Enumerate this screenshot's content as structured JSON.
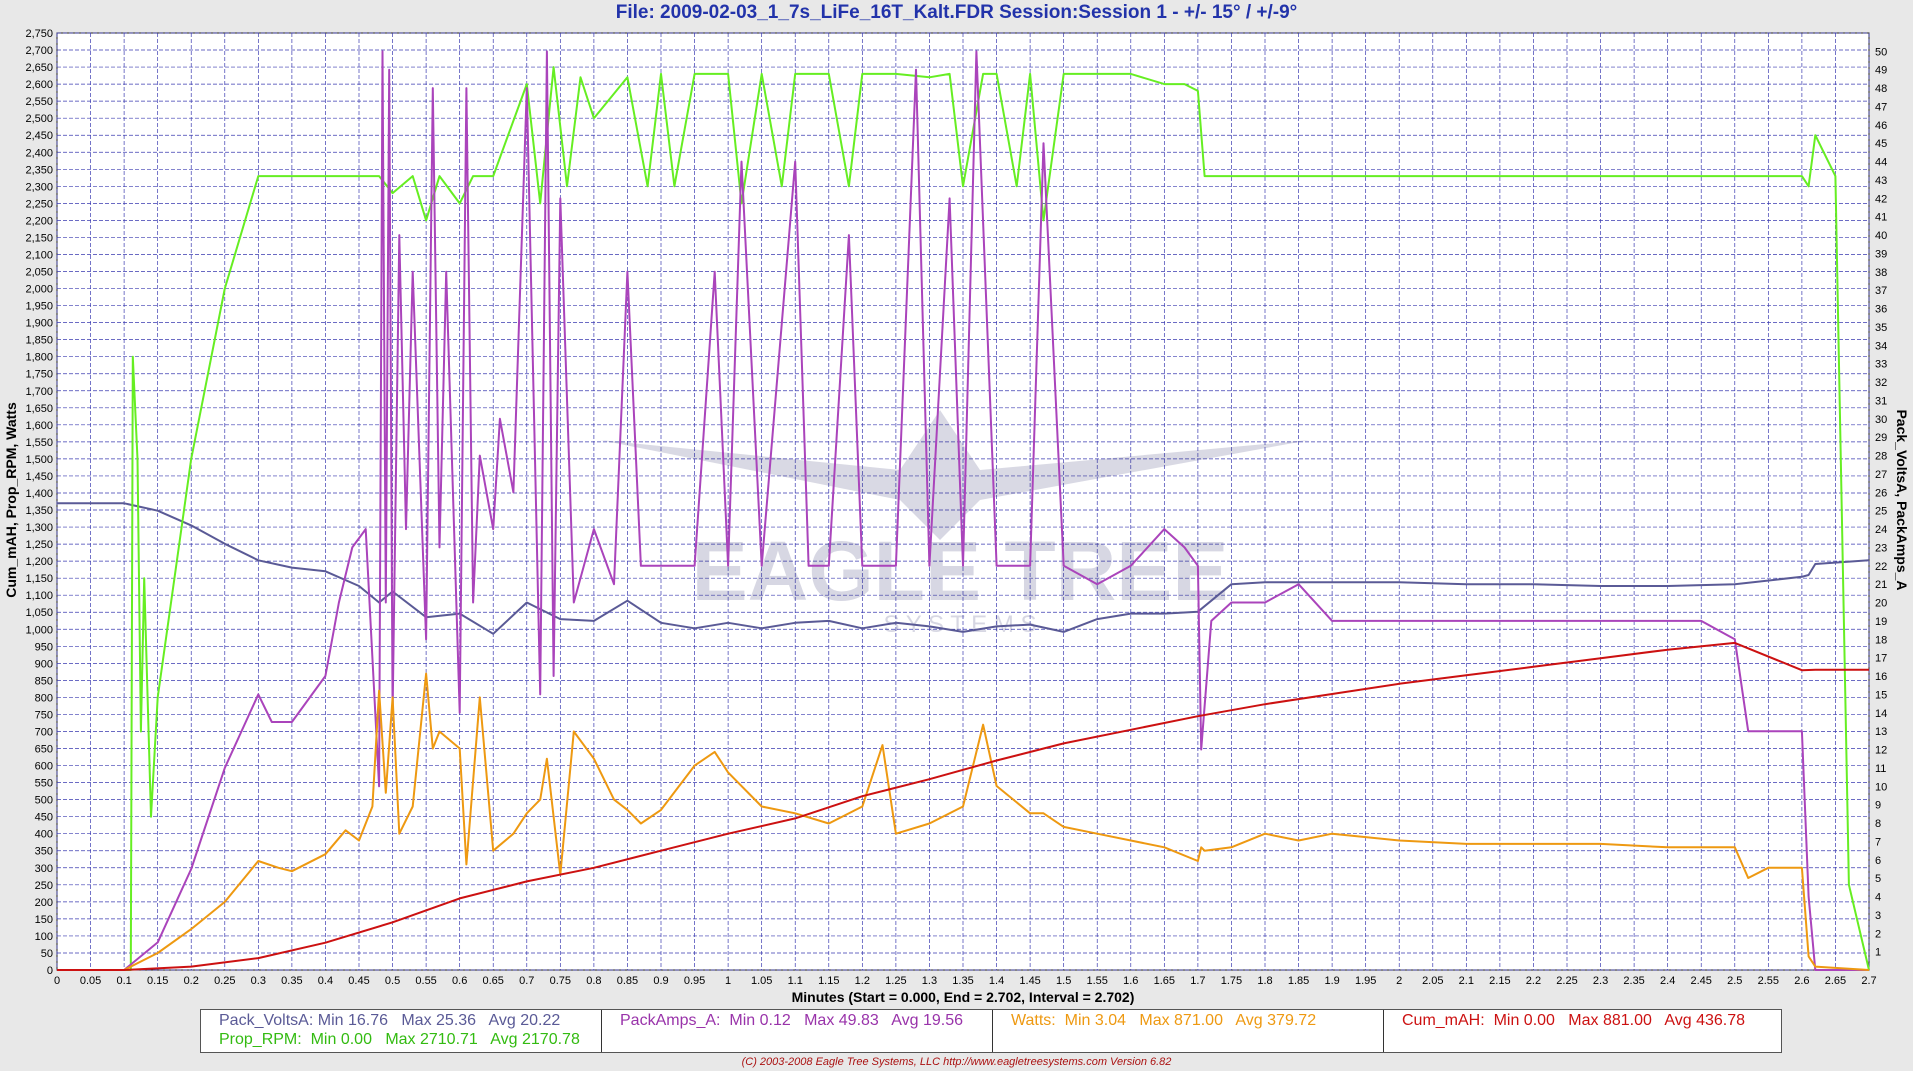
{
  "title": "File: 2009-02-03_1_7s_LiFe_16T_Kalt.FDR   Session:Session 1 - +/- 15° / +/-9°",
  "watermark": {
    "line1": "EAGLE TREE",
    "line2": "S Y S T E M S"
  },
  "chart_data": {
    "type": "line",
    "xlabel": "Minutes (Start = 0.000,  End = 2.702,  Interval =  2.702)",
    "ylabel_left": "Cum_mAH, Prop_RPM, Watts",
    "ylabel_right": "Pack_VoltsA, PackAmps_A",
    "xlim": [
      0,
      2.7
    ],
    "ylim_left": [
      0,
      2750
    ],
    "ylim_right": [
      0,
      51
    ],
    "x_ticks": [
      "0",
      "0.05",
      "0.1",
      "0.15",
      "0.2",
      "0.25",
      "0.3",
      "0.35",
      "0.4",
      "0.45",
      "0.5",
      "0.55",
      "0.6",
      "0.65",
      "0.7",
      "0.75",
      "0.8",
      "0.85",
      "0.9",
      "0.95",
      "1",
      "1.05",
      "1.1",
      "1.15",
      "1.2",
      "1.25",
      "1.3",
      "1.35",
      "1.4",
      "1.45",
      "1.5",
      "1.55",
      "1.6",
      "1.65",
      "1.7",
      "1.75",
      "1.8",
      "1.85",
      "1.9",
      "1.95",
      "2",
      "2.05",
      "2.1",
      "2.15",
      "2.2",
      "2.25",
      "2.3",
      "2.35",
      "2.4",
      "2.45",
      "2.5",
      "2.55",
      "2.6",
      "2.65",
      "2.7"
    ],
    "y_left_ticks": [
      "0",
      "50",
      "100",
      "150",
      "200",
      "250",
      "300",
      "350",
      "400",
      "450",
      "500",
      "550",
      "600",
      "650",
      "700",
      "750",
      "800",
      "850",
      "900",
      "950",
      "1,000",
      "1,050",
      "1,100",
      "1,150",
      "1,200",
      "1,250",
      "1,300",
      "1,350",
      "1,400",
      "1,450",
      "1,500",
      "1,550",
      "1,600",
      "1,650",
      "1,700",
      "1,750",
      "1,800",
      "1,850",
      "1,900",
      "1,950",
      "2,000",
      "2,050",
      "2,100",
      "2,150",
      "2,200",
      "2,250",
      "2,300",
      "2,350",
      "2,400",
      "2,450",
      "2,500",
      "2,550",
      "2,600",
      "2,650",
      "2,700",
      "2,750"
    ],
    "y_right_ticks": [
      "1",
      "2",
      "3",
      "4",
      "5",
      "6",
      "7",
      "8",
      "9",
      "10",
      "11",
      "12",
      "13",
      "14",
      "15",
      "16",
      "17",
      "18",
      "19",
      "20",
      "21",
      "22",
      "23",
      "24",
      "25",
      "26",
      "27",
      "28",
      "29",
      "30",
      "31",
      "32",
      "33",
      "34",
      "35",
      "36",
      "37",
      "38",
      "39",
      "40",
      "41",
      "42",
      "43",
      "44",
      "45",
      "46",
      "47",
      "48",
      "49",
      "50"
    ],
    "grid": true,
    "series": [
      {
        "name": "Pack_VoltsA",
        "axis": "right",
        "color": "#5a5a96",
        "x": [
          0,
          0.1,
          0.15,
          0.2,
          0.25,
          0.3,
          0.35,
          0.4,
          0.45,
          0.48,
          0.5,
          0.55,
          0.6,
          0.65,
          0.7,
          0.75,
          0.8,
          0.85,
          0.9,
          0.95,
          1,
          1.05,
          1.1,
          1.15,
          1.2,
          1.25,
          1.3,
          1.35,
          1.4,
          1.45,
          1.5,
          1.55,
          1.6,
          1.65,
          1.7,
          1.75,
          1.8,
          1.9,
          2,
          2.1,
          2.2,
          2.3,
          2.4,
          2.5,
          2.6,
          2.61,
          2.62,
          2.7
        ],
        "values": [
          25.4,
          25.4,
          25.0,
          24.2,
          23.2,
          22.3,
          21.9,
          21.7,
          20.9,
          20.0,
          20.6,
          19.2,
          19.4,
          18.3,
          20.0,
          19.1,
          19.0,
          20.1,
          18.9,
          18.6,
          18.9,
          18.6,
          18.9,
          19.0,
          18.6,
          18.9,
          18.7,
          18.4,
          18.7,
          18.8,
          18.4,
          19.1,
          19.4,
          19.4,
          19.5,
          21.0,
          21.1,
          21.1,
          21.1,
          21.0,
          21.0,
          20.9,
          20.9,
          21.0,
          21.4,
          21.5,
          22.1,
          22.3
        ]
      },
      {
        "name": "Prop_RPM",
        "axis": "left",
        "color": "#66ee22",
        "x": [
          0,
          0.11,
          0.113,
          0.12,
          0.125,
          0.13,
          0.14,
          0.15,
          0.2,
          0.25,
          0.3,
          0.31,
          0.45,
          0.48,
          0.5,
          0.53,
          0.55,
          0.57,
          0.6,
          0.62,
          0.65,
          0.7,
          0.72,
          0.74,
          0.76,
          0.78,
          0.8,
          0.85,
          0.88,
          0.9,
          0.92,
          0.95,
          1,
          1.02,
          1.05,
          1.08,
          1.1,
          1.15,
          1.18,
          1.2,
          1.25,
          1.3,
          1.33,
          1.35,
          1.38,
          1.4,
          1.43,
          1.45,
          1.47,
          1.5,
          1.55,
          1.6,
          1.65,
          1.68,
          1.7,
          1.71,
          2.0,
          2.3,
          2.6,
          2.61,
          2.62,
          2.65,
          2.67,
          2.7
        ],
        "values": [
          0,
          0,
          1800,
          1500,
          700,
          1150,
          450,
          800,
          1500,
          2000,
          2330,
          2330,
          2330,
          2330,
          2280,
          2330,
          2200,
          2330,
          2250,
          2330,
          2330,
          2600,
          2250,
          2650,
          2300,
          2620,
          2500,
          2620,
          2300,
          2630,
          2300,
          2630,
          2630,
          2250,
          2630,
          2300,
          2630,
          2630,
          2300,
          2630,
          2630,
          2620,
          2630,
          2300,
          2630,
          2630,
          2300,
          2630,
          2200,
          2630,
          2630,
          2630,
          2600,
          2600,
          2580,
          2330,
          2330,
          2330,
          2330,
          2300,
          2450,
          2330,
          250,
          0
        ]
      },
      {
        "name": "PackAmps_A",
        "axis": "right",
        "color": "#aa44bb",
        "x": [
          0,
          0.1,
          0.15,
          0.2,
          0.25,
          0.3,
          0.32,
          0.35,
          0.4,
          0.42,
          0.44,
          0.46,
          0.48,
          0.485,
          0.49,
          0.495,
          0.5,
          0.51,
          0.52,
          0.53,
          0.55,
          0.56,
          0.57,
          0.58,
          0.6,
          0.61,
          0.62,
          0.63,
          0.65,
          0.66,
          0.68,
          0.7,
          0.72,
          0.73,
          0.74,
          0.75,
          0.77,
          0.8,
          0.83,
          0.85,
          0.87,
          0.9,
          0.95,
          0.98,
          1,
          1.02,
          1.05,
          1.1,
          1.12,
          1.15,
          1.18,
          1.2,
          1.25,
          1.28,
          1.3,
          1.33,
          1.35,
          1.37,
          1.4,
          1.45,
          1.47,
          1.5,
          1.55,
          1.6,
          1.65,
          1.68,
          1.7,
          1.705,
          1.72,
          1.75,
          1.8,
          1.85,
          1.9,
          2.0,
          2.1,
          2.2,
          2.3,
          2.4,
          2.45,
          2.5,
          2.52,
          2.55,
          2.58,
          2.6,
          2.61,
          2.62,
          2.7
        ],
        "values": [
          0,
          0,
          1.5,
          5.5,
          11,
          15,
          13.5,
          13.5,
          16,
          20,
          23,
          24,
          10,
          50,
          20,
          49,
          14,
          40,
          24,
          38,
          18,
          48,
          23,
          38,
          14,
          48,
          20,
          28,
          24,
          30,
          26,
          48,
          15,
          50,
          16,
          42,
          20,
          24,
          21,
          38,
          22,
          22,
          22,
          38,
          22,
          44,
          22,
          44,
          22,
          22,
          40,
          22,
          22,
          49,
          22,
          42,
          22,
          50,
          22,
          22,
          45,
          22,
          21,
          22,
          24,
          23,
          22,
          12,
          19,
          20,
          20,
          21,
          19,
          19,
          19,
          19,
          19,
          19,
          19,
          18,
          13,
          13,
          13,
          13,
          4,
          0,
          0
        ]
      },
      {
        "name": "Watts",
        "axis": "left",
        "color": "#ee9911",
        "x": [
          0,
          0.1,
          0.15,
          0.2,
          0.25,
          0.3,
          0.33,
          0.35,
          0.4,
          0.43,
          0.45,
          0.47,
          0.48,
          0.49,
          0.5,
          0.51,
          0.53,
          0.55,
          0.56,
          0.57,
          0.6,
          0.61,
          0.63,
          0.65,
          0.68,
          0.7,
          0.72,
          0.73,
          0.75,
          0.77,
          0.8,
          0.83,
          0.85,
          0.87,
          0.9,
          0.95,
          0.98,
          1,
          1.05,
          1.1,
          1.15,
          1.2,
          1.23,
          1.25,
          1.3,
          1.35,
          1.38,
          1.4,
          1.45,
          1.47,
          1.5,
          1.55,
          1.6,
          1.65,
          1.7,
          1.705,
          1.71,
          1.75,
          1.8,
          1.85,
          1.9,
          2.0,
          2.1,
          2.2,
          2.3,
          2.4,
          2.45,
          2.5,
          2.52,
          2.55,
          2.6,
          2.61,
          2.62,
          2.7
        ],
        "values": [
          0,
          0,
          50,
          120,
          200,
          320,
          300,
          290,
          340,
          410,
          380,
          480,
          820,
          520,
          800,
          400,
          480,
          870,
          650,
          700,
          650,
          310,
          800,
          350,
          400,
          460,
          500,
          620,
          280,
          700,
          620,
          500,
          470,
          430,
          470,
          600,
          640,
          580,
          480,
          460,
          430,
          480,
          660,
          400,
          430,
          480,
          720,
          540,
          460,
          460,
          420,
          400,
          380,
          360,
          320,
          360,
          350,
          360,
          400,
          380,
          400,
          380,
          370,
          370,
          370,
          360,
          360,
          360,
          270,
          300,
          300,
          40,
          10,
          0
        ]
      },
      {
        "name": "Cum_mAH",
        "axis": "left",
        "color": "#cc1111",
        "x": [
          0,
          0.1,
          0.2,
          0.3,
          0.4,
          0.5,
          0.6,
          0.7,
          0.8,
          0.9,
          1.0,
          1.1,
          1.2,
          1.3,
          1.4,
          1.5,
          1.6,
          1.7,
          1.8,
          1.9,
          2.0,
          2.1,
          2.2,
          2.3,
          2.4,
          2.5,
          2.6,
          2.62,
          2.7
        ],
        "values": [
          0,
          0,
          10,
          35,
          80,
          140,
          210,
          260,
          300,
          350,
          400,
          445,
          510,
          560,
          615,
          665,
          705,
          745,
          780,
          810,
          840,
          865,
          890,
          915,
          940,
          960,
          880,
          881,
          881
        ]
      }
    ],
    "stats": [
      {
        "name": "Pack_VoltsA",
        "min": "Min 16.76",
        "max": "Max 25.36",
        "avg": "Avg 20.22"
      },
      {
        "name": "Prop_RPM",
        "min": "Min 0.00",
        "max": "Max 2710.71",
        "avg": "Avg 2170.78"
      },
      {
        "name": "PackAmps_A",
        "min": "Min 0.12",
        "max": "Max 49.83",
        "avg": "Avg 19.56"
      },
      {
        "name": "Watts",
        "min": "Min 3.04",
        "max": "Max 871.00",
        "avg": "Avg 379.72"
      },
      {
        "name": "Cum_mAH",
        "min": "Min 0.00",
        "max": "Max 881.00",
        "avg": "Avg 436.78"
      }
    ]
  },
  "legend": {
    "volts": {
      "label": "Pack_VoltsA:",
      "min": "Min 16.76",
      "max": "Max 25.36",
      "avg": "Avg 20.22",
      "color": "#5a5a96"
    },
    "rpm": {
      "label": "Prop_RPM:",
      "min": "Min 0.00",
      "max": "Max 2710.71",
      "avg": "Avg 2170.78",
      "color": "#33bb11"
    },
    "amps": {
      "label": "PackAmps_A:",
      "min": "Min 0.12",
      "max": "Max 49.83",
      "avg": "Avg 19.56",
      "color": "#9933aa"
    },
    "watts": {
      "label": "Watts:",
      "min": "Min 3.04",
      "max": "Max 871.00",
      "avg": "Avg 379.72",
      "color": "#ee9911"
    },
    "cum": {
      "label": "Cum_mAH:",
      "min": "Min 0.00",
      "max": "Max 881.00",
      "avg": "Avg 436.78",
      "color": "#cc1111"
    }
  },
  "copyright": "(C) 2003-2008 Eagle Tree Systems, LLC      http://www.eagletreesystems.com      Version 6.82"
}
